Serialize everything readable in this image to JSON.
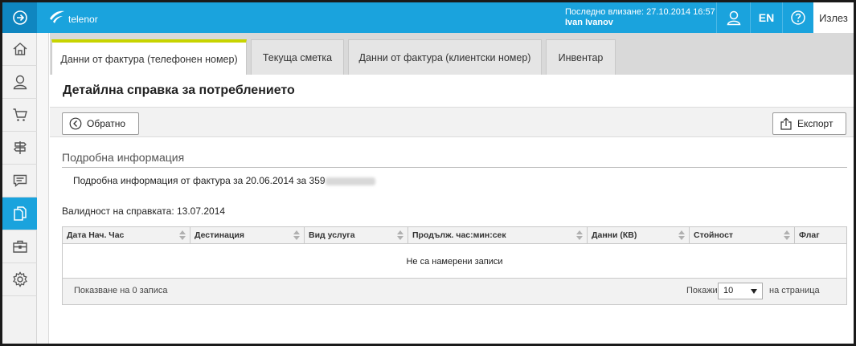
{
  "header": {
    "brand": "telenor",
    "last_login": "Последно влизане: 27.10.2014 16:57",
    "user_name": "Ivan Ivanov",
    "lang": "EN",
    "exit_label": "Излез"
  },
  "sidebar": {
    "items": [
      {
        "icon": "home-icon",
        "active": false
      },
      {
        "icon": "user-icon",
        "active": false
      },
      {
        "icon": "cart-icon",
        "active": false
      },
      {
        "icon": "signpost-icon",
        "active": false
      },
      {
        "icon": "chat-icon",
        "active": false
      },
      {
        "icon": "documents-icon",
        "active": true
      },
      {
        "icon": "briefcase-icon",
        "active": false
      },
      {
        "icon": "gear-icon",
        "active": false
      }
    ]
  },
  "tabs": [
    {
      "label": "Данни от фактура (телефонен номер)",
      "active": true
    },
    {
      "label": "Текуща сметка",
      "active": false
    },
    {
      "label": "Данни от фактура (клиентски номер)",
      "active": false
    },
    {
      "label": "Инвентар",
      "active": false
    }
  ],
  "page": {
    "title": "Детайлна справка за потреблението",
    "back_label": "Обратно",
    "export_label": "Експорт",
    "section_title": "Подробна информация",
    "detail_text": "Подробна информация от фактура за 20.06.2014 за 359",
    "validity": "Валидност на справката: 13.07.2014"
  },
  "table": {
    "columns": [
      "Дата Нач. Час",
      "Дестинация",
      "Вид услуга",
      "Продълж. час:мин:сек",
      "Данни (КВ)",
      "Стойност",
      "Флаг"
    ],
    "empty_message": "Не са намерени записи",
    "showing": "Показване на 0 записа",
    "page_size_label": "Покажи",
    "page_size": "10",
    "page_size_suffix": "на страница"
  },
  "colors": {
    "brand_blue": "#1aa3dd",
    "active_tab_accent": "#c8d400"
  }
}
